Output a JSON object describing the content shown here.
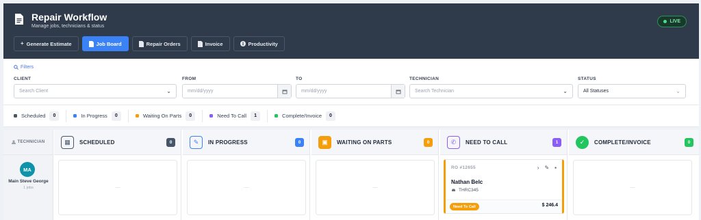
{
  "header": {
    "title": "Repair Workflow",
    "subtitle": "Manage jobs, technicians & status",
    "live_label": "LIVE",
    "tabs": [
      {
        "label": "Generate Estimate",
        "icon": "plus-icon"
      },
      {
        "label": "Job Board",
        "icon": "document-icon",
        "active": true
      },
      {
        "label": "Repair Orders",
        "icon": "document-icon"
      },
      {
        "label": "Invoice",
        "icon": "document-icon"
      },
      {
        "label": "Productivity",
        "icon": "info-icon"
      }
    ]
  },
  "filters": {
    "toggle_label": "Filters",
    "client": {
      "label": "CLIENT",
      "placeholder": "Search Client"
    },
    "from": {
      "label": "FROM",
      "placeholder": "mm/dd/yyyy"
    },
    "to": {
      "label": "TO",
      "placeholder": "mm/dd/yyyy"
    },
    "technician": {
      "label": "TECHNICIAN",
      "placeholder": "Search Technician"
    },
    "status": {
      "label": "STATUS",
      "value": "All Statuses"
    }
  },
  "status_counts": [
    {
      "label": "Scheduled",
      "count": "0",
      "color": "#4b5563"
    },
    {
      "label": "In Progress",
      "count": "0",
      "color": "#3b82f6"
    },
    {
      "label": "Waiting On Parts",
      "count": "0",
      "color": "#f59e0b"
    },
    {
      "label": "Need To Call",
      "count": "1",
      "color": "#8b5cf6"
    },
    {
      "label": "Complete/Invoice",
      "count": "0",
      "color": "#22c55e"
    }
  ],
  "board": {
    "technician_header": "TECHNICIAN",
    "technician": {
      "initials": "MA",
      "name": "Main Steve George",
      "jobs": "1 jobs"
    },
    "columns": [
      {
        "title": "SCHEDULED",
        "count": "0",
        "color": "#475569",
        "icon": "calendar-icon",
        "empty": "—"
      },
      {
        "title": "IN PROGRESS",
        "count": "0",
        "color": "#3b82f6",
        "icon": "wrench-icon",
        "empty": "—"
      },
      {
        "title": "WAITING ON PARTS",
        "count": "0",
        "color": "#f59e0b",
        "icon": "parts-box-icon",
        "empty": "—"
      },
      {
        "title": "NEED TO CALL",
        "count": "1",
        "color": "#8b5cf6",
        "icon": "phone-icon"
      },
      {
        "title": "COMPLETE/INVOICE",
        "count": "0",
        "color": "#22c55e",
        "icon": "check-circle-icon",
        "empty": "—"
      }
    ],
    "card": {
      "ro": "RO #12655",
      "customer": "Nathan Belc",
      "plate": "THRC345",
      "status_badge": "Need To Call",
      "amount": "$ 246.4"
    }
  }
}
